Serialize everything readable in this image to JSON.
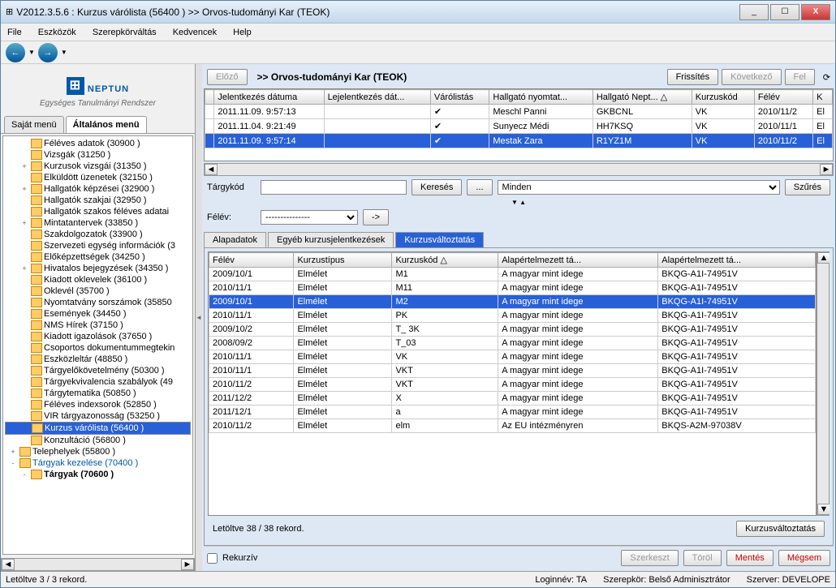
{
  "title": "V2012.3.5.6 : Kurzus várólista (56400 )  >> Orvos-tudományi Kar (TEOK)",
  "menu": [
    "File",
    "Eszközök",
    "Szerepkörváltás",
    "Kedvencek",
    "Help"
  ],
  "logo": {
    "brand": "NEPTUN",
    "sub": "Egységes Tanulmányi Rendszer"
  },
  "sideTabs": [
    "Saját menü",
    "Általános menü"
  ],
  "tree": [
    {
      "l": "Féléves adatok (30900 )",
      "i": 1
    },
    {
      "l": "Vizsgák (31250 )",
      "i": 1
    },
    {
      "l": "Kurzusok vizsgái (31350 )",
      "i": 1,
      "p": "+"
    },
    {
      "l": "Elküldött üzenetek (32150 )",
      "i": 1
    },
    {
      "l": "Hallgatók képzései (32900 )",
      "i": 1,
      "p": "+"
    },
    {
      "l": "Hallgatók szakjai (32950 )",
      "i": 1
    },
    {
      "l": "Hallgatók szakos féléves adatai",
      "i": 1
    },
    {
      "l": "Mintatantervek (33850 )",
      "i": 1,
      "p": "+"
    },
    {
      "l": "Szakdolgozatok (33900 )",
      "i": 1
    },
    {
      "l": "Szervezeti egység információk (3",
      "i": 1
    },
    {
      "l": "Előképzettségek (34250 )",
      "i": 1
    },
    {
      "l": "Hivatalos bejegyzések (34350 )",
      "i": 1,
      "p": "+"
    },
    {
      "l": "Kiadott oklevelek (36100 )",
      "i": 1
    },
    {
      "l": "Oklevél (35700 )",
      "i": 1
    },
    {
      "l": "Nyomtatvány sorszámok (35850",
      "i": 1
    },
    {
      "l": "Események (34450 )",
      "i": 1
    },
    {
      "l": "NMS Hírek (37150 )",
      "i": 1
    },
    {
      "l": "Kiadott igazolások (37650 )",
      "i": 1
    },
    {
      "l": "Csoportos dokumentummegtekin",
      "i": 1
    },
    {
      "l": "Eszközleltár (48850 )",
      "i": 1
    },
    {
      "l": "Tárgyelőkövetelmény (50300 )",
      "i": 1
    },
    {
      "l": "Tárgyekvivalencia szabályok (49",
      "i": 1
    },
    {
      "l": "Tárgytematika (50850 )",
      "i": 1
    },
    {
      "l": "Féléves indexsorok (52850 )",
      "i": 1
    },
    {
      "l": "VIR tárgyazonosság (53250 )",
      "i": 1
    },
    {
      "l": "Kurzus várólista (56400 )",
      "i": 1,
      "sel": true
    },
    {
      "l": "Konzultáció (56800 )",
      "i": 1
    },
    {
      "l": "Telephelyek (55800 )",
      "i": 0,
      "p": "+"
    },
    {
      "l": "Tárgyak kezelése (70400 )",
      "i": 0,
      "p": "-",
      "bl": true
    },
    {
      "l": "Tárgyak (70600 )",
      "i": 1,
      "p": "-",
      "bold": true
    }
  ],
  "header": {
    "prev": "Előző",
    "title": ">> Orvos-tudományi Kar (TEOK)",
    "refresh": "Frissítés",
    "next": "Következő",
    "up": "Fel"
  },
  "g1": {
    "cols": [
      "",
      "Jelentkezés dátuma",
      "Lejelentkezés dát...",
      "Várólistás",
      "Hallgató nyomtat...",
      "Hallgató Nept... △",
      "Kurzuskód",
      "Félév",
      "K"
    ],
    "rows": [
      [
        "",
        "2011.11.09. 9:57:13",
        "",
        "✔",
        "Meschl Panni",
        "GKBCNL",
        "VK",
        "2010/11/2",
        "El"
      ],
      [
        "",
        "2011.11.04. 9:21:49",
        "",
        "✔",
        "Sunyecz Médi",
        "HH7KSQ",
        "VK",
        "2010/11/1",
        "El"
      ],
      [
        "",
        "2011.11.09. 9:57:14",
        "",
        "✔",
        "Mestak Zara",
        "R1YZ1M",
        "VK",
        "2010/11/2",
        "El"
      ]
    ]
  },
  "filter": {
    "targy": "Tárgykód",
    "search": "Keresés",
    "minden": "Minden",
    "szures": "Szűrés"
  },
  "felev": {
    "label": "Félév:",
    "val": "---------------",
    "go": "->"
  },
  "subTabs": [
    "Alapadatok",
    "Egyéb kurzusjelentkezések",
    "Kurzusváltoztatás"
  ],
  "g2": {
    "cols": [
      "Félév",
      "Kurzustípus",
      "Kurzuskód △",
      "Alapértelmezett tá...",
      "Alapértelmezett tá..."
    ],
    "rows": [
      [
        "2009/10/1",
        "Elmélet",
        "M1",
        "A magyar mint idege",
        "BKQG-A1I-74951V"
      ],
      [
        "2010/11/1",
        "Elmélet",
        "M11",
        "A magyar mint idege",
        "BKQG-A1I-74951V"
      ],
      [
        "2009/10/1",
        "Elmélet",
        "M2",
        "A magyar mint idege",
        "BKQG-A1I-74951V",
        true
      ],
      [
        "2010/11/1",
        "Elmélet",
        "PK",
        "A magyar mint idege",
        "BKQG-A1I-74951V"
      ],
      [
        "2009/10/2",
        "Elmélet",
        "T_ 3K",
        "A magyar mint idege",
        "BKQG-A1I-74951V"
      ],
      [
        "2008/09/2",
        "Elmélet",
        "T_03",
        "A magyar mint idege",
        "BKQG-A1I-74951V"
      ],
      [
        "2010/11/1",
        "Elmélet",
        "VK",
        "A magyar mint idege",
        "BKQG-A1I-74951V"
      ],
      [
        "2010/11/1",
        "Elmélet",
        "VKT",
        "A magyar mint idege",
        "BKQG-A1I-74951V"
      ],
      [
        "2010/11/2",
        "Elmélet",
        "VKT",
        "A magyar mint idege",
        "BKQG-A1I-74951V"
      ],
      [
        "2011/12/2",
        "Elmélet",
        "X",
        "A magyar mint idege",
        "BKQG-A1I-74951V"
      ],
      [
        "2011/12/1",
        "Elmélet",
        "a",
        "A magyar mint idege",
        "BKQG-A1I-74951V"
      ],
      [
        "2010/11/2",
        "Elmélet",
        "elm",
        "Az EU intézményren",
        "BKQS-A2M-97038V"
      ]
    ]
  },
  "rec2": "Letöltve 38 / 38 rekord.",
  "kurzvalt": "Kurzusváltoztatás",
  "bottom": {
    "rekurziv": "Rekurzív",
    "szerk": "Szerkeszt",
    "torol": "Töröl",
    "mentes": "Mentés",
    "megsem": "Mégsem"
  },
  "status": {
    "rec": "Letöltve 3 / 3 rekord.",
    "login": "Loginnév: TA",
    "role": "Szerepkör: Belső Adminisztrátor",
    "server": "Szerver: DEVELOPE"
  }
}
